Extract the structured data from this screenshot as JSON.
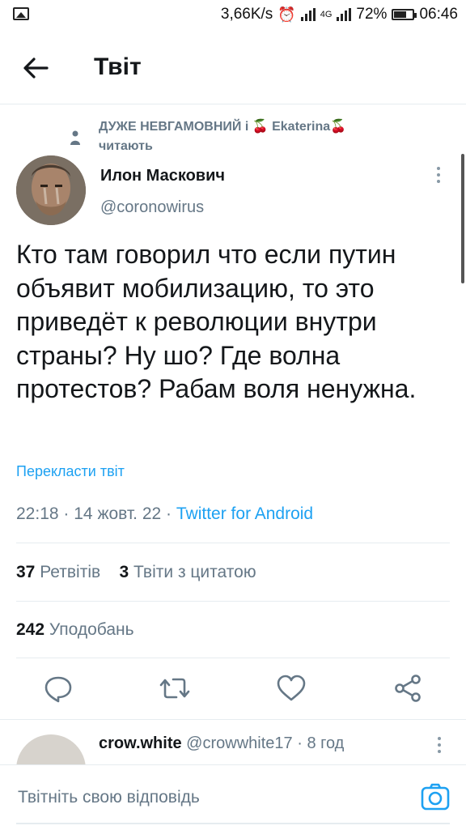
{
  "status_bar": {
    "speed": "3,66K/s",
    "network": "4G",
    "battery": "72%",
    "battery_level": 0.72,
    "time": "06:46"
  },
  "header": {
    "title": "Твіт",
    "back_icon": "arrow-left-icon"
  },
  "social_context": {
    "names": "ДУЖЕ НЕВГАМОВНИЙ і 🍒 Ekaterina🍒",
    "action": "читають"
  },
  "tweet": {
    "author_name": "Илон Маскович",
    "handle": "@coronowirus",
    "text": "Кто там говорил что если путин объявит мобилизацию, то это приведёт к революции внутри страны? Ну шо? Где волна протестов? Рабам воля ненужна.",
    "translate": "Перекласти твіт",
    "time": "22:18",
    "date": "14 жовт. 22",
    "separator": "·",
    "client": "Twitter for Android"
  },
  "stats": {
    "retweets_count": "37",
    "retweets_label": "Ретвітів",
    "quotes_count": "3",
    "quotes_label": "Твіти з цитатою",
    "likes_count": "242",
    "likes_label": "Уподобань"
  },
  "actions": [
    "reply-icon",
    "retweet-icon",
    "like-icon",
    "share-icon"
  ],
  "reply_preview": {
    "name": "crow.white",
    "handle": "@crowwhite17",
    "separator": "·",
    "time": "8 год"
  },
  "compose": {
    "placeholder": "Твітніть свою відповідь"
  },
  "colors": {
    "accent": "#1da1f2",
    "secondary_text": "#657786",
    "divider": "#e6ecf0"
  }
}
